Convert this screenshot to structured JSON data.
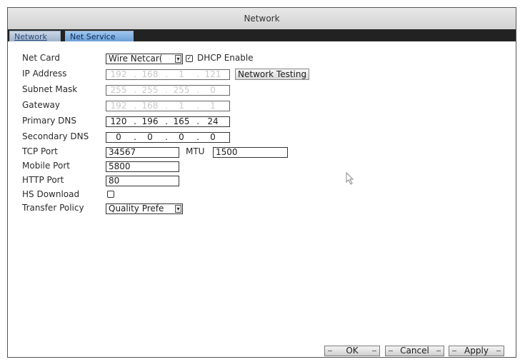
{
  "window": {
    "title": "Network"
  },
  "tabs": [
    {
      "label": "Network",
      "active": false
    },
    {
      "label": "Net Service",
      "active": true
    }
  ],
  "form": {
    "net_card": {
      "label": "Net Card",
      "value": "Wire Netcar("
    },
    "dhcp": {
      "label": "DHCP Enable",
      "checked": true
    },
    "ip_address": {
      "label": "IP Address",
      "octets": [
        "192",
        "168",
        "1",
        "121"
      ],
      "disabled": true
    },
    "network_testing": {
      "label": "Network Testing"
    },
    "subnet_mask": {
      "label": "Subnet Mask",
      "octets": [
        "255",
        "255",
        "255",
        "0"
      ],
      "disabled": true
    },
    "gateway": {
      "label": "Gateway",
      "octets": [
        "192",
        "168",
        "1",
        "1"
      ],
      "disabled": true
    },
    "primary_dns": {
      "label": "Primary DNS",
      "octets": [
        "120",
        "196",
        "165",
        "24"
      ]
    },
    "secondary_dns": {
      "label": "Secondary DNS",
      "octets": [
        "0",
        "0",
        "0",
        "0"
      ]
    },
    "tcp_port": {
      "label": "TCP Port",
      "value": "34567"
    },
    "mtu": {
      "label": "MTU",
      "value": "1500"
    },
    "mobile_port": {
      "label": "Mobile Port",
      "value": "5800"
    },
    "http_port": {
      "label": "HTTP Port",
      "value": "80"
    },
    "hs_download": {
      "label": "HS Download",
      "checked": false
    },
    "transfer_policy": {
      "label": "Transfer Policy",
      "value": "Quality Prefe"
    }
  },
  "buttons": {
    "ok": "OK",
    "cancel": "Cancel",
    "apply": "Apply"
  },
  "colors": {
    "tab_active": "#6b9fd6",
    "tab_bar": "#222222",
    "disabled_text": "#c8c8c8"
  }
}
